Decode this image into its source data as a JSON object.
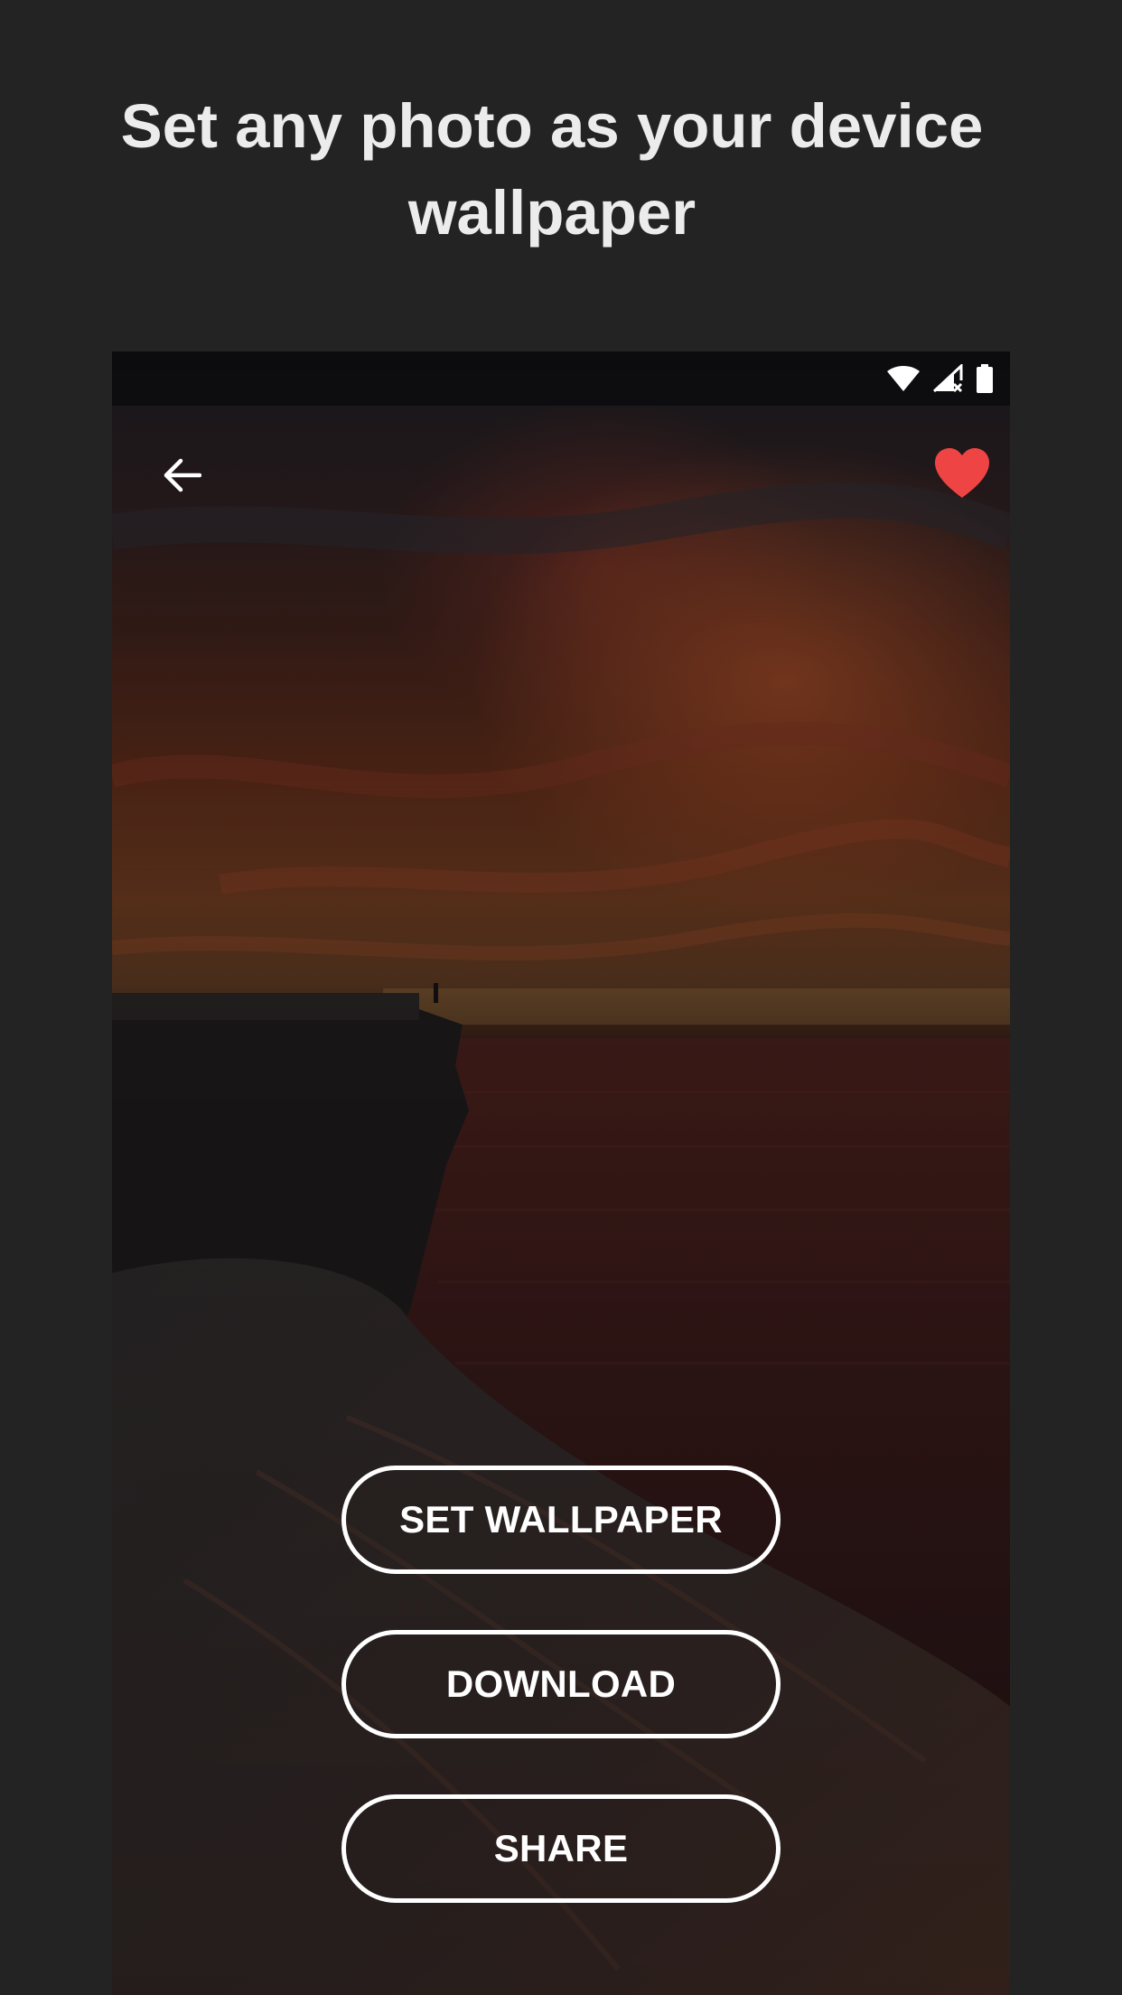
{
  "promo": {
    "title_line1": "Set any photo as your device",
    "title_line2": "wallpaper"
  },
  "device": {
    "status_bar": {
      "icons": [
        "wifi-icon",
        "cellular-signal-off-icon",
        "battery-icon"
      ]
    },
    "app_bar": {
      "back_icon": "arrow-back-icon",
      "favorite_icon": "heart-icon",
      "favorite_color": "#ef4444"
    },
    "wallpaper": {
      "subject": "sunset-sea-cliff-photo"
    },
    "actions": {
      "set_wallpaper": "SET WALLPAPER",
      "download": "DOWNLOAD",
      "share": "SHARE"
    }
  },
  "colors": {
    "page_background": "#232323",
    "title_text": "#ececec",
    "button_outline": "#ffffff"
  }
}
